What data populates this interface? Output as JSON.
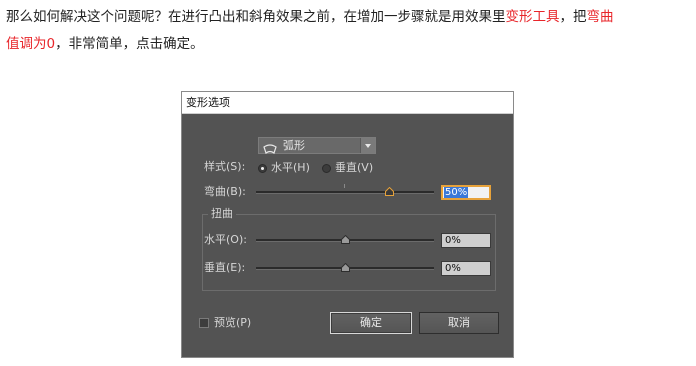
{
  "article": {
    "line1_a": "那么如何解决这个问题呢？在进行凸出和斜角效果之前，在增加一步骤就是用效果里",
    "line1_highlight": "变形工具",
    "line1_b": "，把",
    "line1_highlight2": "弯曲",
    "line2_highlight": "值调为0",
    "line2_b": "，非常简单，点击确定。"
  },
  "dialog": {
    "title": "变形选项",
    "style_label": "样式(S):",
    "style_value": "弧形",
    "radio_horizontal": "水平(H)",
    "radio_vertical": "垂直(V)",
    "orientation_selected": "horizontal",
    "bend_label": "弯曲(B):",
    "bend_value": "50%",
    "distortion_group": "扭曲",
    "horizontal_label": "水平(O):",
    "horizontal_value": "0%",
    "vertical_label": "垂直(E):",
    "vertical_value": "0%",
    "preview_label": "预览(P)",
    "preview_checked": false,
    "ok_label": "确定",
    "cancel_label": "取消",
    "accent_color": "#e7a23a",
    "highlight_text_color": "#e8252a"
  }
}
